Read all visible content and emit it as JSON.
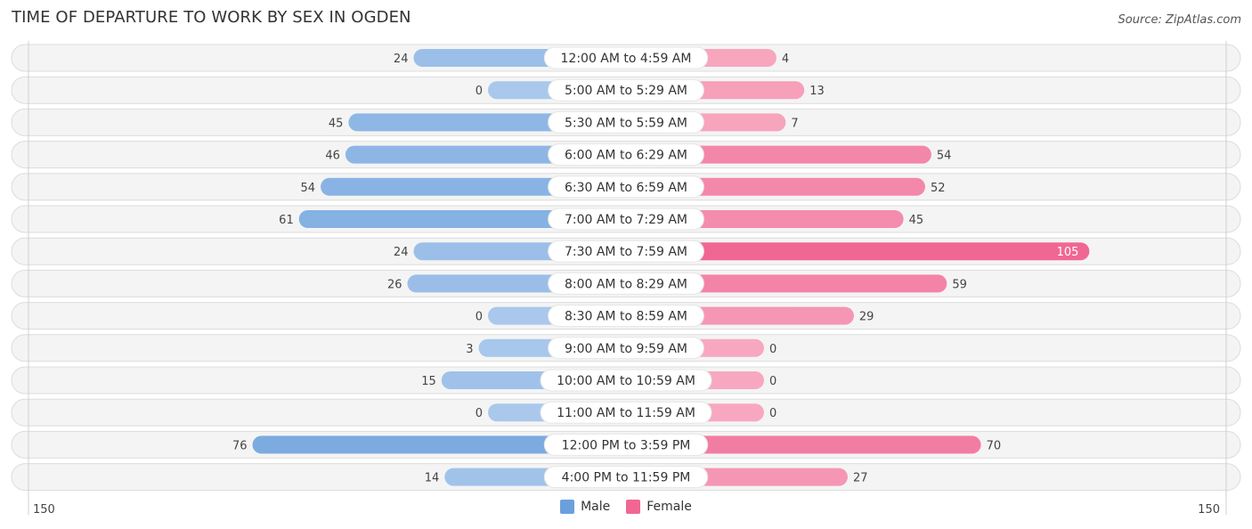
{
  "header": {
    "title": "TIME OF DEPARTURE TO WORK BY SEX IN OGDEN",
    "source": "Source: ZipAtlas.com"
  },
  "colors": {
    "male": "#6ba0dc",
    "male_light": "#a9c8ec",
    "female": "#f06793",
    "female_light": "#f7a8c0"
  },
  "legend": {
    "male_label": "Male",
    "female_label": "Female"
  },
  "axis": {
    "left_tick": "150",
    "right_tick": "150"
  },
  "chart_data": {
    "type": "bar",
    "orientation": "horizontal-diverging",
    "title": "TIME OF DEPARTURE TO WORK BY SEX IN OGDEN",
    "xlabel": "",
    "ylabel": "",
    "xlim": [
      -150,
      150
    ],
    "legend_position": "bottom-center",
    "categories": [
      "12:00 AM to 4:59 AM",
      "5:00 AM to 5:29 AM",
      "5:30 AM to 5:59 AM",
      "6:00 AM to 6:29 AM",
      "6:30 AM to 6:59 AM",
      "7:00 AM to 7:29 AM",
      "7:30 AM to 7:59 AM",
      "8:00 AM to 8:29 AM",
      "8:30 AM to 8:59 AM",
      "9:00 AM to 9:59 AM",
      "10:00 AM to 10:59 AM",
      "11:00 AM to 11:59 AM",
      "12:00 PM to 3:59 PM",
      "4:00 PM to 11:59 PM"
    ],
    "series": [
      {
        "name": "Male",
        "side": "left",
        "values": [
          24,
          0,
          45,
          46,
          54,
          61,
          24,
          26,
          0,
          3,
          15,
          0,
          76,
          14
        ]
      },
      {
        "name": "Female",
        "side": "right",
        "values": [
          4,
          13,
          7,
          54,
          52,
          45,
          105,
          59,
          29,
          0,
          0,
          0,
          70,
          27
        ]
      }
    ]
  }
}
